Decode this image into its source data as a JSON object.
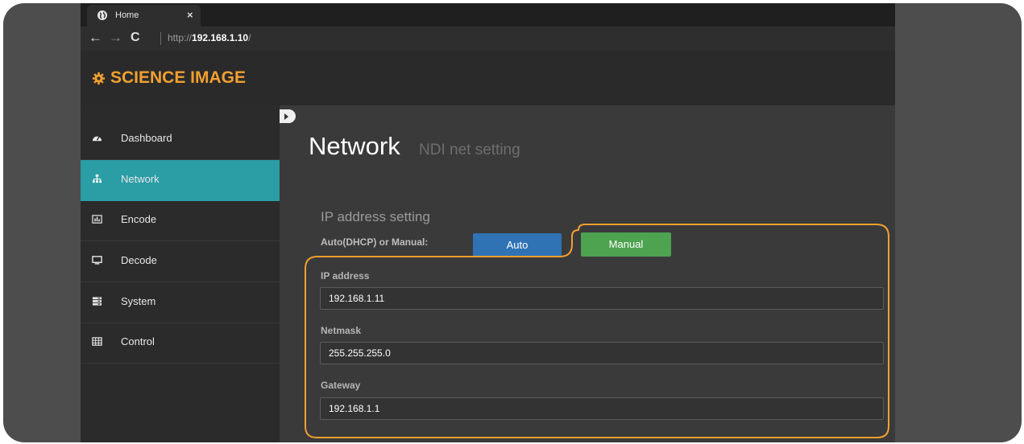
{
  "browser": {
    "tab_title": "Home",
    "tab_close": "×",
    "url_prefix": "http://",
    "url_host": "192.168.1.10",
    "url_suffix": "/"
  },
  "app": {
    "brand": "SCIENCE IMAGE"
  },
  "sidebar": {
    "items": [
      {
        "label": "Dashboard",
        "icon": "dashboard-icon"
      },
      {
        "label": "Network",
        "icon": "sitemap-icon",
        "active": true
      },
      {
        "label": "Encode",
        "icon": "bar-chart-icon"
      },
      {
        "label": "Decode",
        "icon": "monitor-icon"
      },
      {
        "label": "System",
        "icon": "server-icon"
      },
      {
        "label": "Control",
        "icon": "grid-table-icon"
      }
    ]
  },
  "main": {
    "title": "Network",
    "subtitle": "NDI net setting",
    "section": "IP address setting",
    "mode_label": "Auto(DHCP) or Manual:",
    "auto_button": "Auto",
    "manual_button": "Manual",
    "fields": {
      "ip_label": "IP address",
      "ip_value": "192.168.1.11",
      "netmask_label": "Netmask",
      "netmask_value": "255.255.255.0",
      "gateway_label": "Gateway",
      "gateway_value": "192.168.1.1"
    }
  },
  "colors": {
    "brand": "#f0a030",
    "active_nav": "#2a9da5",
    "auto_button": "#2f73b5",
    "manual_button": "#4ea350",
    "highlight_outline": "#f0a030"
  }
}
